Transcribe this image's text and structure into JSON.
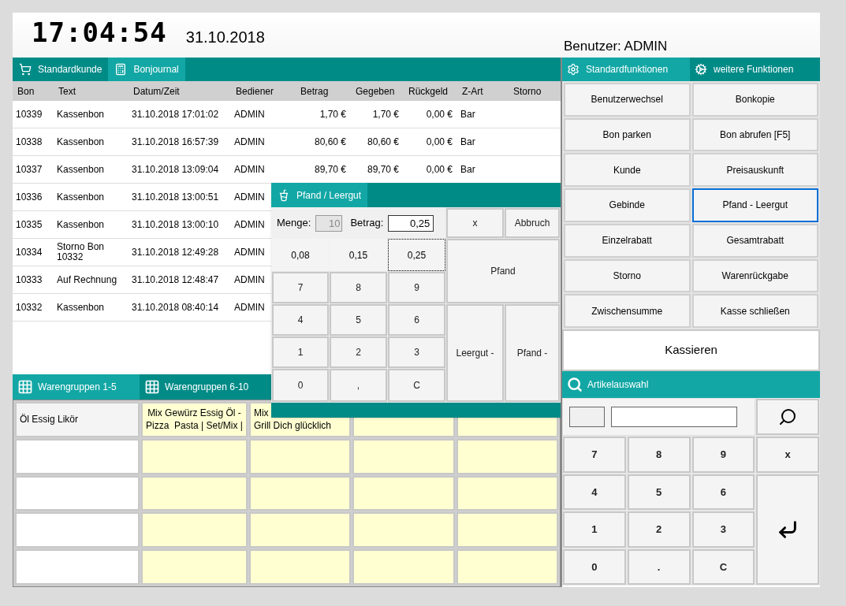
{
  "header": {
    "clock": "17:04:54",
    "date": "31.10.2018",
    "user": "Benutzer: ADMIN"
  },
  "left_tabs": [
    {
      "label": "Standardkunde",
      "selected": false
    },
    {
      "label": "Bonjournal",
      "selected": true
    }
  ],
  "table": {
    "columns": [
      "Bon",
      "Text",
      "Datum/Zeit",
      "Bediener",
      "Betrag",
      "Gegeben",
      "Rückgeld",
      "Z-Art",
      "Storno"
    ],
    "rows": [
      [
        "10339",
        "Kassenbon",
        "31.10.2018 17:01:02",
        "ADMIN",
        "1,70 €",
        "1,70 €",
        "0,00 €",
        "Bar"
      ],
      [
        "10338",
        "Kassenbon",
        "31.10.2018 16:57:39",
        "ADMIN",
        "80,60 €",
        "80,60 €",
        "0,00 €",
        "Bar"
      ],
      [
        "10337",
        "Kassenbon",
        "31.10.2018 13:09:04",
        "ADMIN",
        "89,70 €",
        "89,70 €",
        "0,00 €",
        "Bar"
      ],
      [
        "10336",
        "Kassenbon",
        "31.10.2018 13:00:51",
        "ADMIN"
      ],
      [
        "10335",
        "Kassenbon",
        "31.10.2018 13:00:10",
        "ADMIN"
      ],
      [
        "10334",
        "Storno Bon 10332",
        "31.10.2018 12:49:28",
        "ADMIN"
      ],
      [
        "10333",
        "Auf Rechnung",
        "31.10.2018 12:48:47",
        "ADMIN"
      ],
      [
        "10332",
        "Kassenbon",
        "31.10.2018 08:40:14",
        "ADMIN"
      ]
    ]
  },
  "group_tabs": [
    {
      "label": "Warengruppen 1-5",
      "selected": true
    },
    {
      "label": "Warengruppen 6-10",
      "selected": false
    }
  ],
  "group_grid": [
    [
      {
        "lines": [
          "Öl Essig Likör"
        ],
        "color": "#f4f4f4"
      },
      {
        "lines": [
          "Mix Gewürz Essig Öl -",
          "Pizza  Pasta | Set/Mix |"
        ],
        "color": "#ffffd2"
      },
      {
        "lines": [
          "Mix",
          "Grill Dich glücklich"
        ],
        "color": "#ffffd2"
      },
      {
        "color": "#ffffd2"
      },
      {
        "color": "#ffffd2"
      }
    ],
    [
      {
        "color": "#ffffff"
      },
      {
        "color": "#ffffd2"
      },
      {
        "color": "#ffffd2"
      },
      {
        "color": "#ffffd2"
      },
      {
        "color": "#ffffd2"
      }
    ],
    [
      {
        "color": "#ffffff"
      },
      {
        "color": "#ffffd2"
      },
      {
        "color": "#ffffd2"
      },
      {
        "color": "#ffffd2"
      },
      {
        "color": "#ffffd2"
      }
    ],
    [
      {
        "color": "#ffffff"
      },
      {
        "color": "#ffffd2"
      },
      {
        "color": "#ffffd2"
      },
      {
        "color": "#ffffd2"
      },
      {
        "color": "#ffffd2"
      }
    ],
    [
      {
        "color": "#ffffff"
      },
      {
        "color": "#ffffd2"
      },
      {
        "color": "#ffffd2"
      },
      {
        "color": "#ffffd2"
      },
      {
        "color": "#ffffd2"
      }
    ]
  ],
  "right_tabs": [
    {
      "label": "Standardfunktionen",
      "selected": true
    },
    {
      "label": "weitere Funktionen",
      "selected": false
    }
  ],
  "functions": [
    {
      "label": "Benutzerwechsel",
      "selected": false
    },
    {
      "label": "Bonkopie",
      "selected": false
    },
    {
      "label": "Bon parken",
      "selected": false
    },
    {
      "label": "Bon abrufen [F5]",
      "selected": false
    },
    {
      "label": "Kunde",
      "selected": false
    },
    {
      "label": "Preisauskunft",
      "selected": false
    },
    {
      "label": "Gebinde",
      "selected": false
    },
    {
      "label": "Pfand - Leergut",
      "selected": true
    },
    {
      "label": "Einzelrabatt",
      "selected": false
    },
    {
      "label": "Gesamtrabatt",
      "selected": false
    },
    {
      "label": "Storno",
      "selected": false
    },
    {
      "label": "Warenrückgabe",
      "selected": false
    },
    {
      "label": "Zwischensumme",
      "selected": false
    },
    {
      "label": "Kasse schließen",
      "selected": false
    }
  ],
  "checkout_button": "Kassieren",
  "article_panel": {
    "title": "Artikelauswahl",
    "keys": [
      "7",
      "8",
      "9",
      "x",
      "4",
      "5",
      "6",
      "1",
      "2",
      "3",
      "0",
      ".",
      "C"
    ]
  },
  "dialog": {
    "title": "Pfand / Leergut",
    "quantity_label": "Menge:",
    "quantity": "10",
    "amount_label": "Betrag:",
    "amount": "0,25",
    "close": "x",
    "cancel": "Abbruch",
    "presets": [
      {
        "label": "0,08",
        "selected": false
      },
      {
        "label": "0,15",
        "selected": false
      },
      {
        "label": "0,25",
        "selected": true
      }
    ],
    "keys": [
      "7",
      "8",
      "9",
      "4",
      "5",
      "6",
      "1",
      "2",
      "3",
      "0",
      ",",
      "C"
    ],
    "deposit": "Pfand",
    "empties_minus": "Leergut -",
    "deposit_minus": "Pfand -"
  }
}
